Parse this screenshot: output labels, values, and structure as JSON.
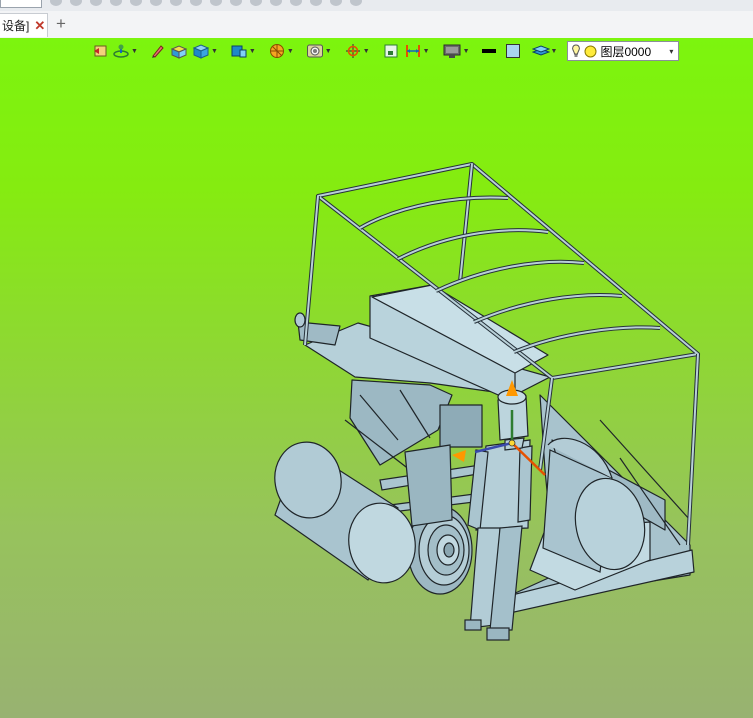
{
  "tabs": {
    "active_label": "设备]",
    "close_glyph": "✕",
    "add_glyph": "+"
  },
  "viewport": {
    "background_top": "#7cf50e",
    "background_bottom": "#98b271",
    "model_color": "#a9c4cf",
    "edge_color": "#20262a"
  },
  "toolbar": {
    "icons": [
      "undo-view-icon",
      "orbit-icon",
      "edit-pen-icon",
      "shaded-view-icon",
      "box-view-icon",
      "standard-view-icon",
      "section-icon",
      "capture-icon",
      "snap-icon",
      "frame-icon",
      "measure-icon",
      "display-mode-icon"
    ],
    "line_color": "#000000",
    "fill_color": "#a9d4f0",
    "layer": {
      "name": "图层0000",
      "dropdown_glyph": "▾"
    }
  }
}
